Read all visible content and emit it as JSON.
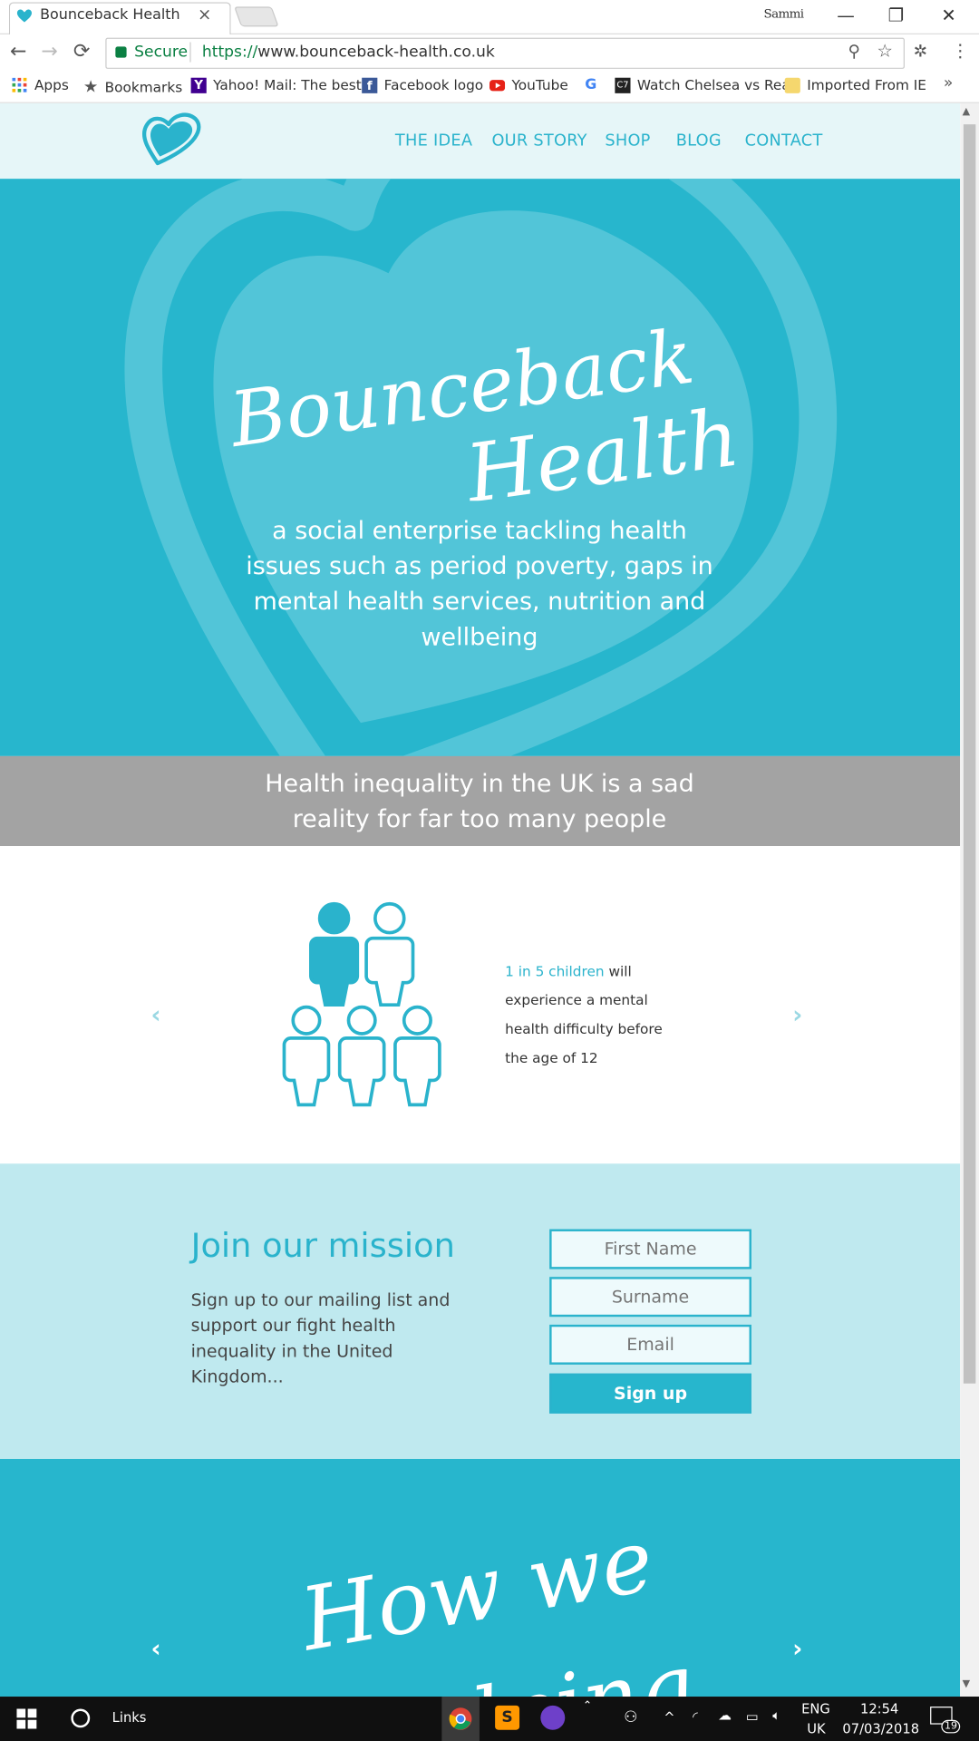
{
  "browser": {
    "tab_title": "Bounceback Health",
    "tab_close": "×",
    "user_name": "Sammi",
    "window_controls": {
      "minimize": "—",
      "restore": "❐",
      "close": "✕"
    },
    "nav": {
      "back": "←",
      "forward": "→",
      "reload": "⟳"
    },
    "secure_label": "Secure",
    "url_scheme": "https://",
    "url_host": "www.bounceback-health.co.uk",
    "bookmarks": [
      {
        "label": "Apps",
        "icon": "apps-grid-icon"
      },
      {
        "label": "Bookmarks",
        "icon": "star-icon"
      },
      {
        "label": "Yahoo! Mail: The best",
        "icon": "yahoo-icon"
      },
      {
        "label": "Facebook logo",
        "icon": "facebook-icon"
      },
      {
        "label": "YouTube",
        "icon": "youtube-icon"
      },
      {
        "label": "",
        "icon": "google-icon"
      },
      {
        "label": "Watch Chelsea vs Rea",
        "icon": "cr7-icon"
      },
      {
        "label": "Imported From IE",
        "icon": "folder-icon"
      }
    ],
    "bookmarks_overflow": "»"
  },
  "site": {
    "nav": [
      "THE IDEA",
      "OUR STORY",
      "SHOP",
      "BLOG",
      "CONTACT"
    ],
    "hero": {
      "title_line1": "Bounceback",
      "title_line2": "Health",
      "subtitle": "a social enterprise tackling health issues such as period poverty, gaps in mental health services, nutrition and wellbeing"
    },
    "band_text": "Health inequality in the UK is a sad reality for far too many people",
    "stat": {
      "highlight": "1 in 5 children",
      "rest": " will experience a mental health difficulty before the age of 12",
      "prev": "‹",
      "next": "›"
    },
    "join": {
      "title": "Join our mission",
      "description": "Sign up to our mailing list and support our fight health inequality in the United Kingdom...",
      "first_name_placeholder": "First Name",
      "surname_placeholder": "Surname",
      "email_placeholder": "Email",
      "signup_label": "Sign up"
    },
    "how": {
      "title_line1": "How we",
      "title_line2": "helping",
      "prev": "‹",
      "next": "›"
    }
  },
  "taskbar": {
    "search_label": "Links",
    "lang_line1": "ENG",
    "lang_line2": "UK",
    "time": "12:54",
    "date": "07/03/2018",
    "notifications": "19"
  },
  "colors": {
    "brand_teal": "#27b6cd",
    "light_teal": "#bfe9ef",
    "band_grey": "#a3a3a3"
  }
}
